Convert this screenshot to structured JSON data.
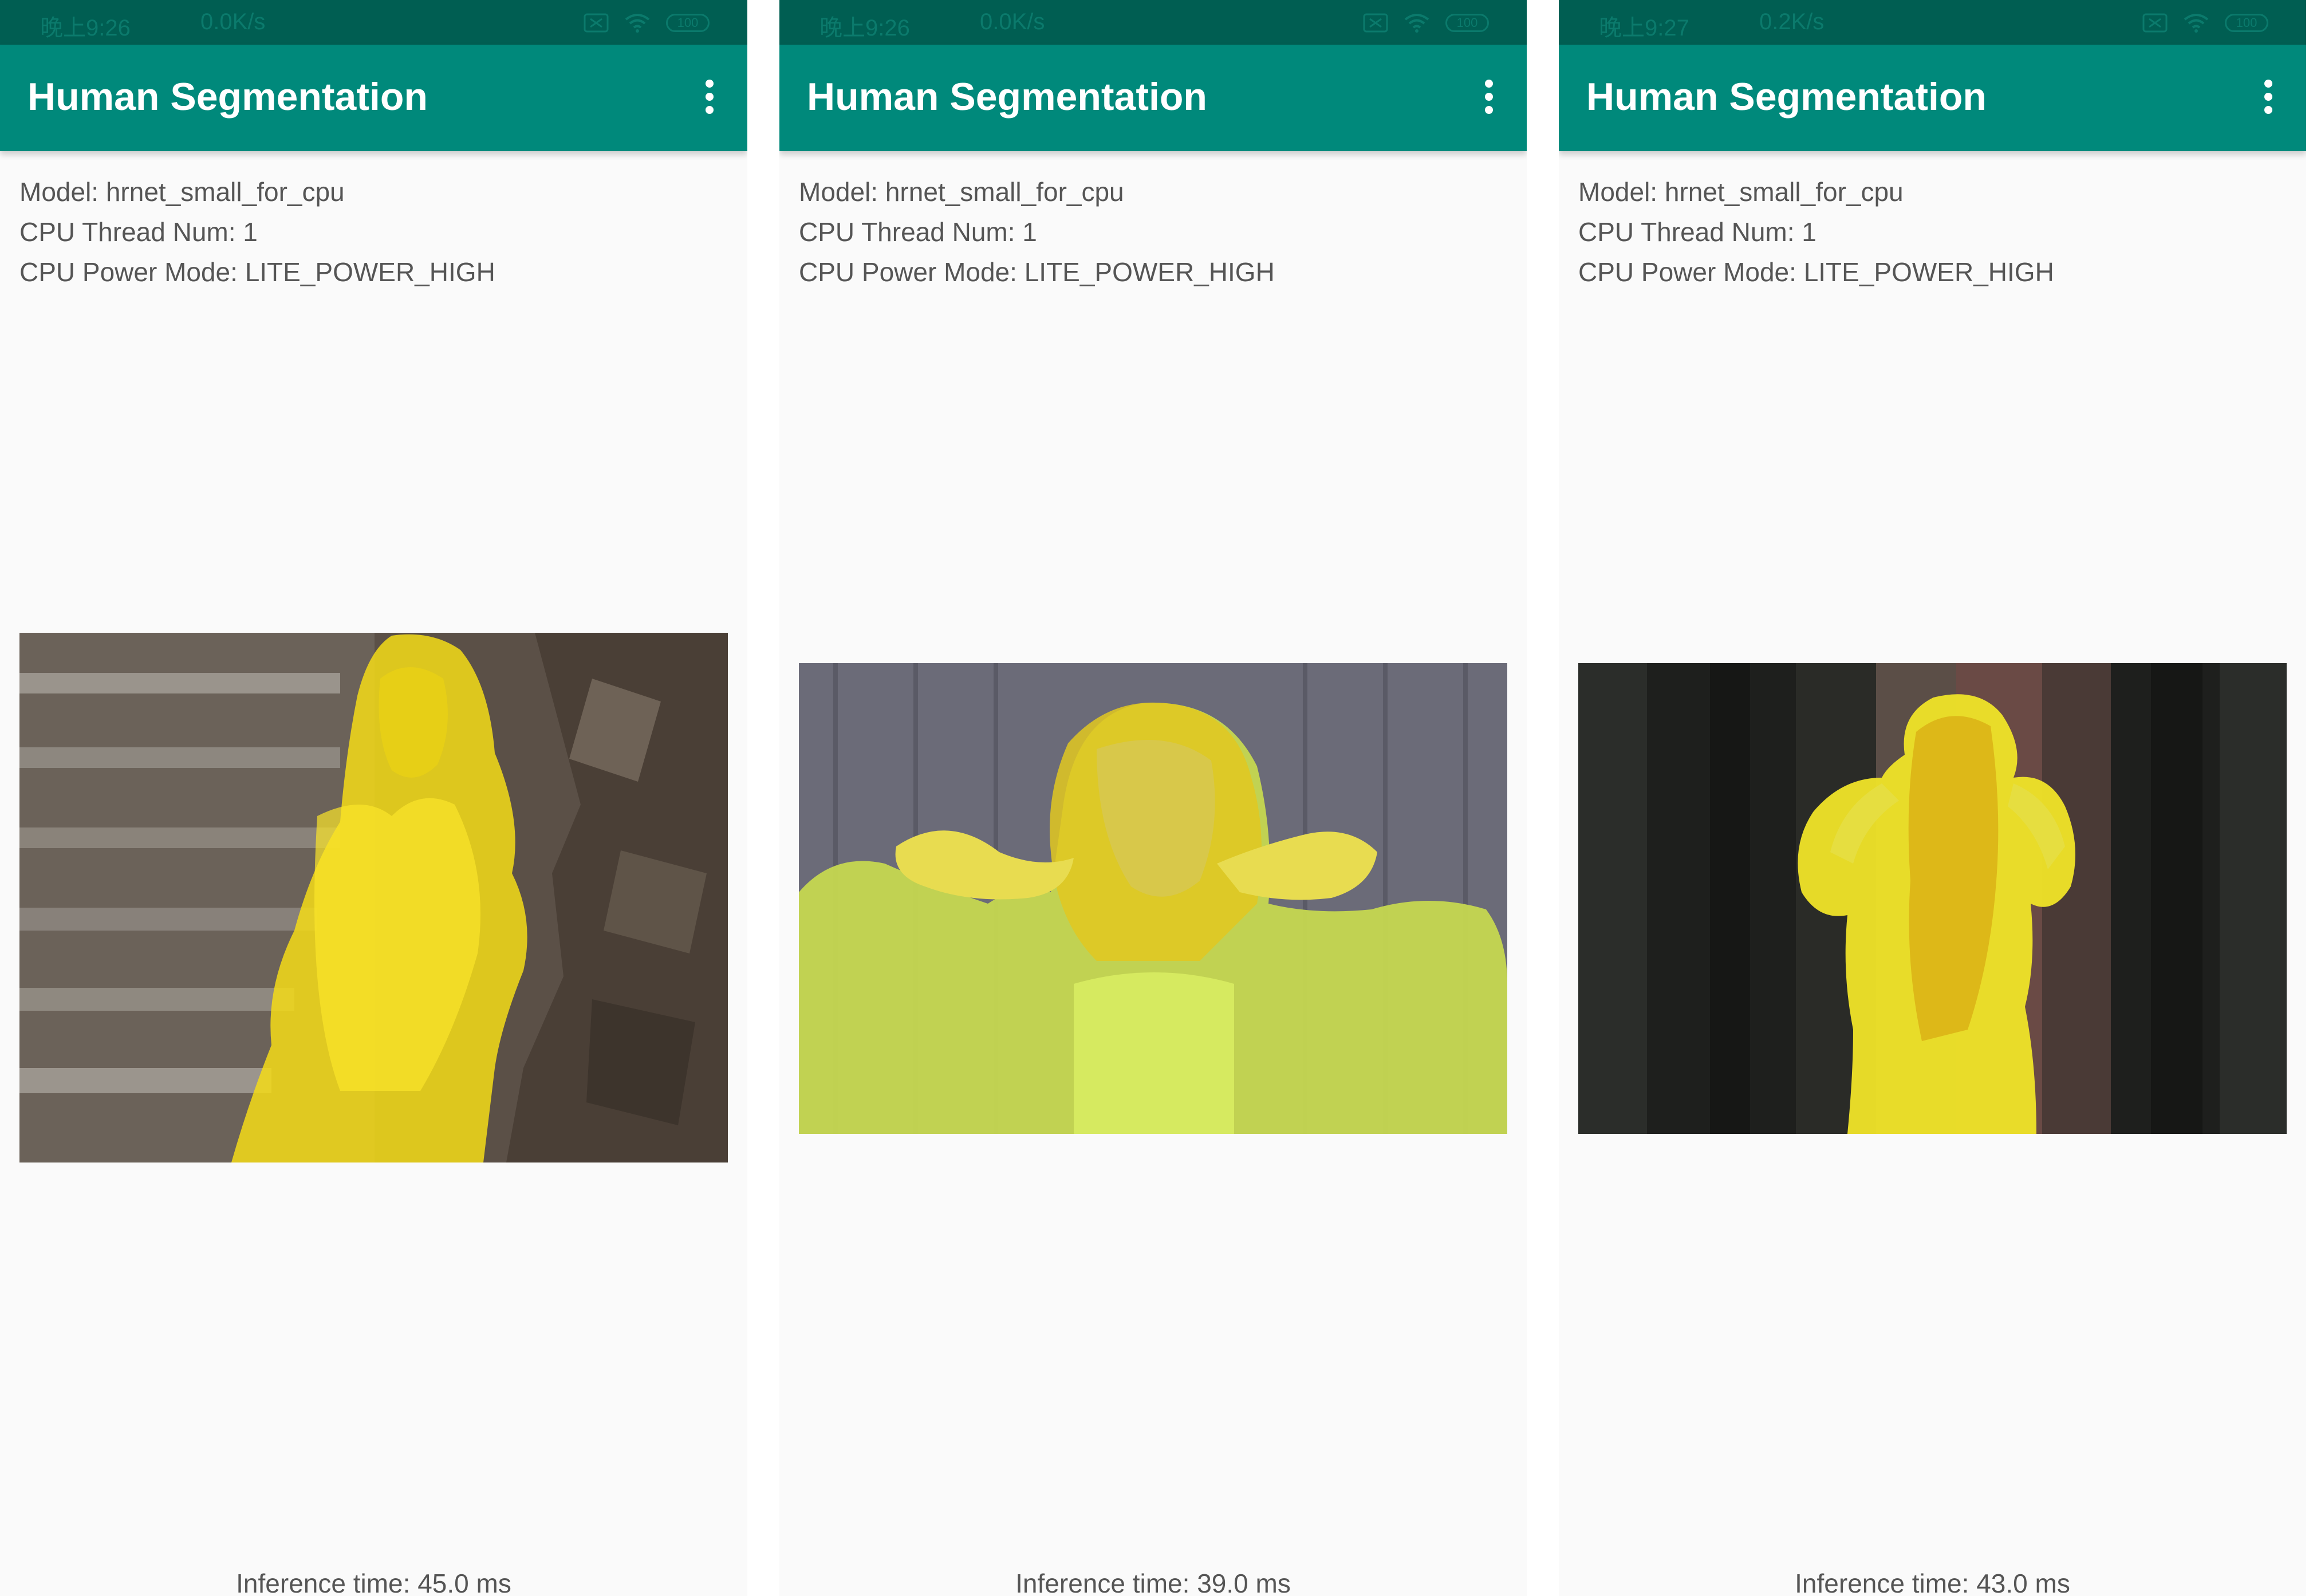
{
  "screens": [
    {
      "status": {
        "time": "晚上9:26",
        "speed": "0.0K/s",
        "battery": "100"
      },
      "app_title": "Human Segmentation",
      "menu_icon": "more-vertical-icon",
      "info": {
        "model": "Model: hrnet_small_for_cpu",
        "threads": "CPU Thread Num: 1",
        "power_mode": "CPU Power Mode: LITE_POWER_HIGH"
      },
      "inference_time": "Inference time: 45.0 ms"
    },
    {
      "status": {
        "time": "晚上9:26",
        "speed": "0.0K/s",
        "battery": "100"
      },
      "app_title": "Human Segmentation",
      "menu_icon": "more-vertical-icon",
      "info": {
        "model": "Model: hrnet_small_for_cpu",
        "threads": "CPU Thread Num: 1",
        "power_mode": "CPU Power Mode: LITE_POWER_HIGH"
      },
      "inference_time": "Inference time: 39.0 ms"
    },
    {
      "status": {
        "time": "晚上9:27",
        "speed": "0.2K/s",
        "battery": "100"
      },
      "app_title": "Human Segmentation",
      "menu_icon": "more-vertical-icon",
      "info": {
        "model": "Model: hrnet_small_for_cpu",
        "threads": "CPU Thread Num: 1",
        "power_mode": "CPU Power Mode: LITE_POWER_HIGH"
      },
      "inference_time": "Inference time: 43.0 ms"
    }
  ],
  "colors": {
    "toolbar": "#00897b",
    "statusbar": "#005e52",
    "mask": "#f5dc18",
    "background": "#fafafa"
  }
}
